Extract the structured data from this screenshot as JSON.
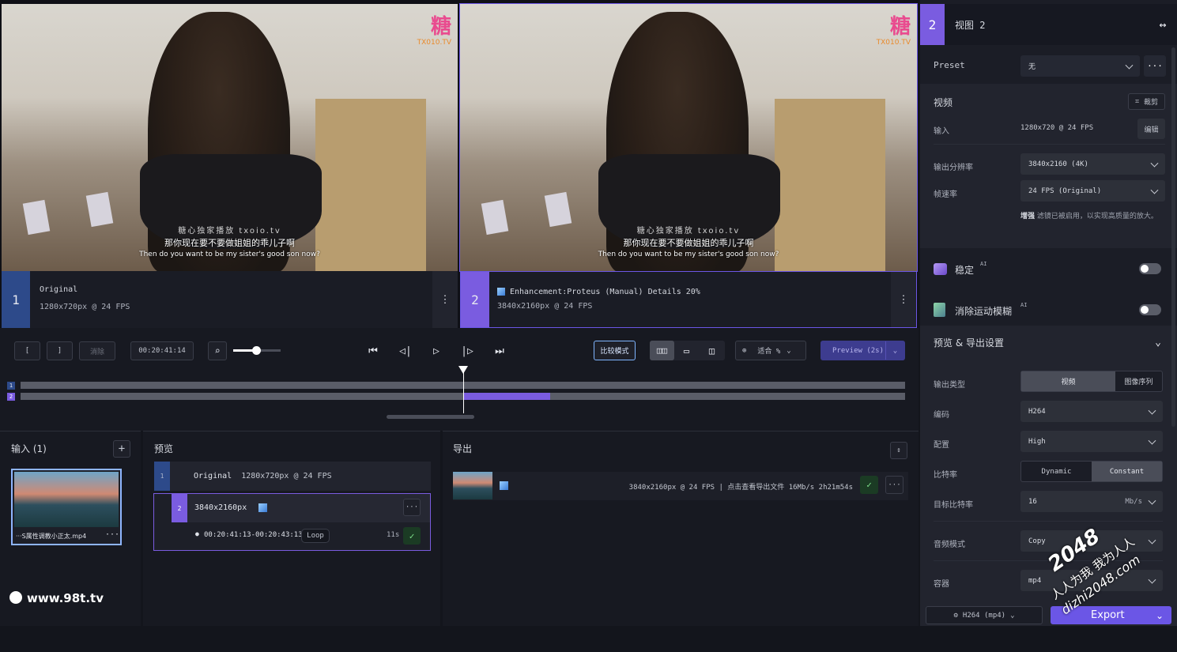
{
  "viewer": {
    "left_frame": {
      "logo": "糖",
      "logo_sub": "TX010.TV",
      "watermark": "糖心独家播放",
      "watermark_sub": "txoio.tv",
      "subtitle_cn": "那你现在要不要做姐姐的乖儿子啊",
      "subtitle_en": "Then do you want to be my sister's good son now?"
    },
    "right_frame": {
      "logo": "糖",
      "logo_sub": "TX010.TV",
      "watermark": "糖心独家播放",
      "watermark_sub": "txoio.tv",
      "subtitle_cn": "那你现在要不要做姐姐的乖儿子啊",
      "subtitle_en": "Then do you want to be my sister's good son now?"
    },
    "view1": {
      "num": "1",
      "title": "Original",
      "info": "1280x720px @ 24 FPS"
    },
    "view2": {
      "num": "2",
      "title": "Enhancement:Proteus (Manual) Details 20%",
      "info": "3840x2160px @ 24 FPS"
    }
  },
  "toolbar": {
    "in_mark": "[",
    "out_mark": "]",
    "clear": "消除",
    "timecode": "00:20:41:14",
    "compare_mode": "比较模式",
    "zoom": "适合 %",
    "preview": "Preview (2s)"
  },
  "timeline": {
    "track1": "1",
    "track2": "2",
    "playhead_fraction": 0.5,
    "range_start_fraction": 0.5,
    "range_end_fraction": 0.598
  },
  "input_panel": {
    "title": "输入 (1)",
    "add": "+",
    "file_name": "···S属性调教小正太.mp4",
    "file_menu": "···"
  },
  "preview_panel": {
    "title": "预览",
    "row1": {
      "num": "1",
      "title": "Original",
      "info": "1280x720px @ 24 FPS"
    },
    "row2": {
      "num": "2",
      "title": "3840x2160px",
      "menu": "···"
    },
    "range": "00:20:41:13-00:20:43:13",
    "loop": "Loop",
    "duration": "11s"
  },
  "export_panel": {
    "title": "导出",
    "row_info": "3840x2160px @ 24 FPS  |  点击查看导出文件  16Mb/s   2h21m54s",
    "menu": "···"
  },
  "right_panel": {
    "view_num": "2",
    "view_title": "视图 2",
    "preset_label": "Preset",
    "preset_value": "无",
    "preset_more": "···",
    "video_header": "视频",
    "crop": "裁剪",
    "input_label": "输入",
    "input_value": "1280x720 @ 24 FPS",
    "edit": "编辑",
    "out_res_label": "输出分辨率",
    "out_res_value": "3840x2160 (4K)",
    "fps_label": "帧速率",
    "fps_value": "24 FPS (Original)",
    "enhance_note_bold": "增强",
    "enhance_note": " 滤镜已被启用，以实现高质量的放大。",
    "stabilize": "稳定",
    "motion_blur": "消除运动模糊",
    "ai": "AI",
    "export_header": "预览 & 导出设置",
    "out_type_label": "输出类型",
    "out_type_video": "视频",
    "out_type_seq": "图像序列",
    "codec_label": "编码",
    "codec_value": "H264",
    "profile_label": "配置",
    "profile_value": "High",
    "bitrate_label": "比特率",
    "bitrate_dynamic": "Dynamic",
    "bitrate_constant": "Constant",
    "target_label": "目标比特率",
    "target_value": "16",
    "target_unit": "Mb/s",
    "audio_label": "音频模式",
    "audio_value": "Copy",
    "container_label": "容器",
    "container_value": "mp4",
    "format_button": "H264 (mp4)",
    "export_button": "Export"
  },
  "overlays": {
    "site": "www.98t.tv",
    "badge_num": "2048",
    "badge_text": "人人为我 我为人人",
    "badge_url": "dizhi2048.com"
  },
  "colors": {
    "accent": "#7a5ce0",
    "view1": "#2d4a8a",
    "export_btn": "#6b56e6"
  }
}
